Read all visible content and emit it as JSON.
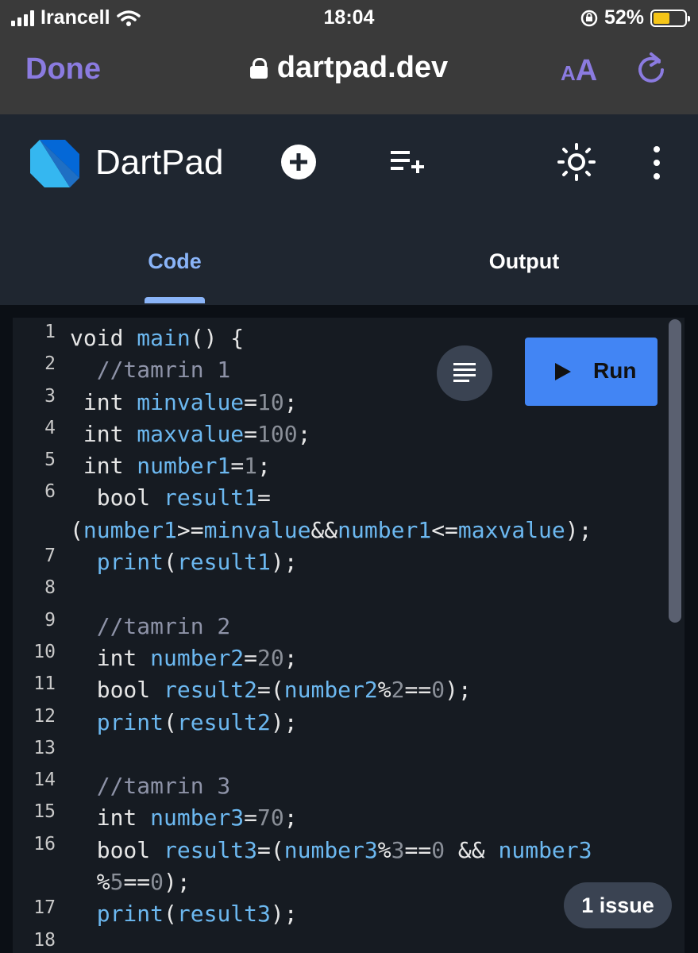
{
  "status_bar": {
    "carrier": "Irancell",
    "time": "18:04",
    "battery": "52%",
    "battery_level": 0.52
  },
  "browser": {
    "done_label": "Done",
    "url": "dartpad.dev",
    "text_size_small": "A",
    "text_size_big": "A"
  },
  "app": {
    "title": "DartPad",
    "tabs": [
      {
        "label": "Code",
        "active": true
      },
      {
        "label": "Output",
        "active": false
      }
    ]
  },
  "editor": {
    "run_label": "Run",
    "issues_label": "1 issue",
    "lines": [
      {
        "n": "1",
        "t": "void main() {"
      },
      {
        "n": "2",
        "t": "  //tamrin 1"
      },
      {
        "n": "3",
        "t": " int minvalue=10;"
      },
      {
        "n": "4",
        "t": " int maxvalue=100;"
      },
      {
        "n": "5",
        "t": " int number1=1;"
      },
      {
        "n": "6",
        "t": "  bool result1="
      },
      {
        "n": "",
        "t": "(number1>=minvalue&&number1<=maxvalue);"
      },
      {
        "n": "7",
        "t": "  print(result1);"
      },
      {
        "n": "8",
        "t": ""
      },
      {
        "n": "9",
        "t": "  //tamrin 2"
      },
      {
        "n": "10",
        "t": "  int number2=20;"
      },
      {
        "n": "11",
        "t": "  bool result2=(number2%2==0);"
      },
      {
        "n": "12",
        "t": "  print(result2);"
      },
      {
        "n": "13",
        "t": ""
      },
      {
        "n": "14",
        "t": "  //tamrin 3"
      },
      {
        "n": "15",
        "t": "  int number3=70;"
      },
      {
        "n": "16",
        "t": "  bool result3=(number3%3==0 && number3"
      },
      {
        "n": "",
        "t": "  %5==0);"
      },
      {
        "n": "17",
        "t": "  print(result3);"
      },
      {
        "n": "18",
        "t": ""
      }
    ]
  }
}
